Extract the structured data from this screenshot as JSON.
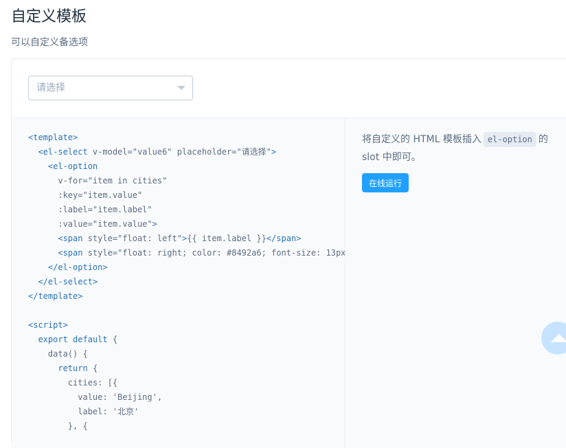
{
  "header": {
    "title": "自定义模板",
    "description": "可以自定义备选项"
  },
  "demo": {
    "select": {
      "placeholder": "请选择",
      "value": ""
    },
    "description": {
      "before": "将自定义的 HTML 模板插入",
      "code": "el-option",
      "after": "的 slot 中即可。"
    },
    "run_label": "在线运行"
  },
  "code": {
    "lines": [
      "<template>",
      "  <el-select v-model=\"value6\" placeholder=\"请选择\">",
      "    <el-option",
      "      v-for=\"item in cities\"",
      "      :key=\"item.value\"",
      "      :label=\"item.label\"",
      "      :value=\"item.value\">",
      "      <span style=\"float: left\">{{ item.label }}</span>",
      "      <span style=\"float: right; color: #8492a6; font-size: 13px",
      "    </el-option>",
      "  </el-select>",
      "</template>",
      "",
      "<script>",
      "  export default {",
      "    data() {",
      "      return {",
      "        cities: [{",
      "          value: 'Beijing',",
      "          label: '北京'",
      "        }, {"
    ]
  },
  "colors": {
    "accent": "#20a0ff",
    "tag": "#2973b7",
    "text": "#5e6d82"
  },
  "icons": {
    "select_caret": "caret-down-icon",
    "back_to_top": "arrow-up-icon"
  }
}
